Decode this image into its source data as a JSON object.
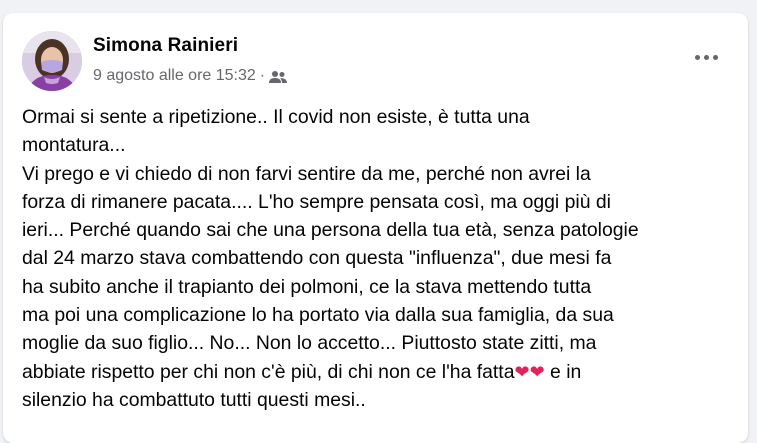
{
  "post": {
    "author": "Simona Rainieri",
    "timestamp": "9 agosto alle ore 15:32",
    "separator": "·",
    "audience_icon": "friends-icon",
    "more_icon": "more-horizontal-icon",
    "text_before_hearts": "Ormai si sente a ripetizione.. Il covid non esiste, è tutta una\nmontatura...\nVi prego e vi chiedo di non farvi sentire da me, perché non avrei la\nforza di rimanere pacata.... L'ho sempre pensata così, ma oggi più di\nieri... Perché quando sai che una persona della tua età, senza patologie\ndal 24 marzo stava combattendo con questa \"influenza\", due mesi fa\nha subito anche il trapianto dei polmoni, ce la stava mettendo tutta\nma poi una complicazione lo ha portato via dalla sua famiglia, da sua\nmoglie da suo figlio... No... Non lo accetto... Piuttosto state zitti, ma\nabbiate rispetto per chi non c'è più, di chi non ce l'ha fatta",
    "hearts": "❤❤",
    "text_after_hearts": " e in\nsilenzio ha combattuto tutti questi mesi..",
    "colors": {
      "name": "#050505",
      "meta": "#65676b",
      "heart": "#e0245e",
      "background": "#f0f2f5",
      "card": "#ffffff"
    }
  }
}
